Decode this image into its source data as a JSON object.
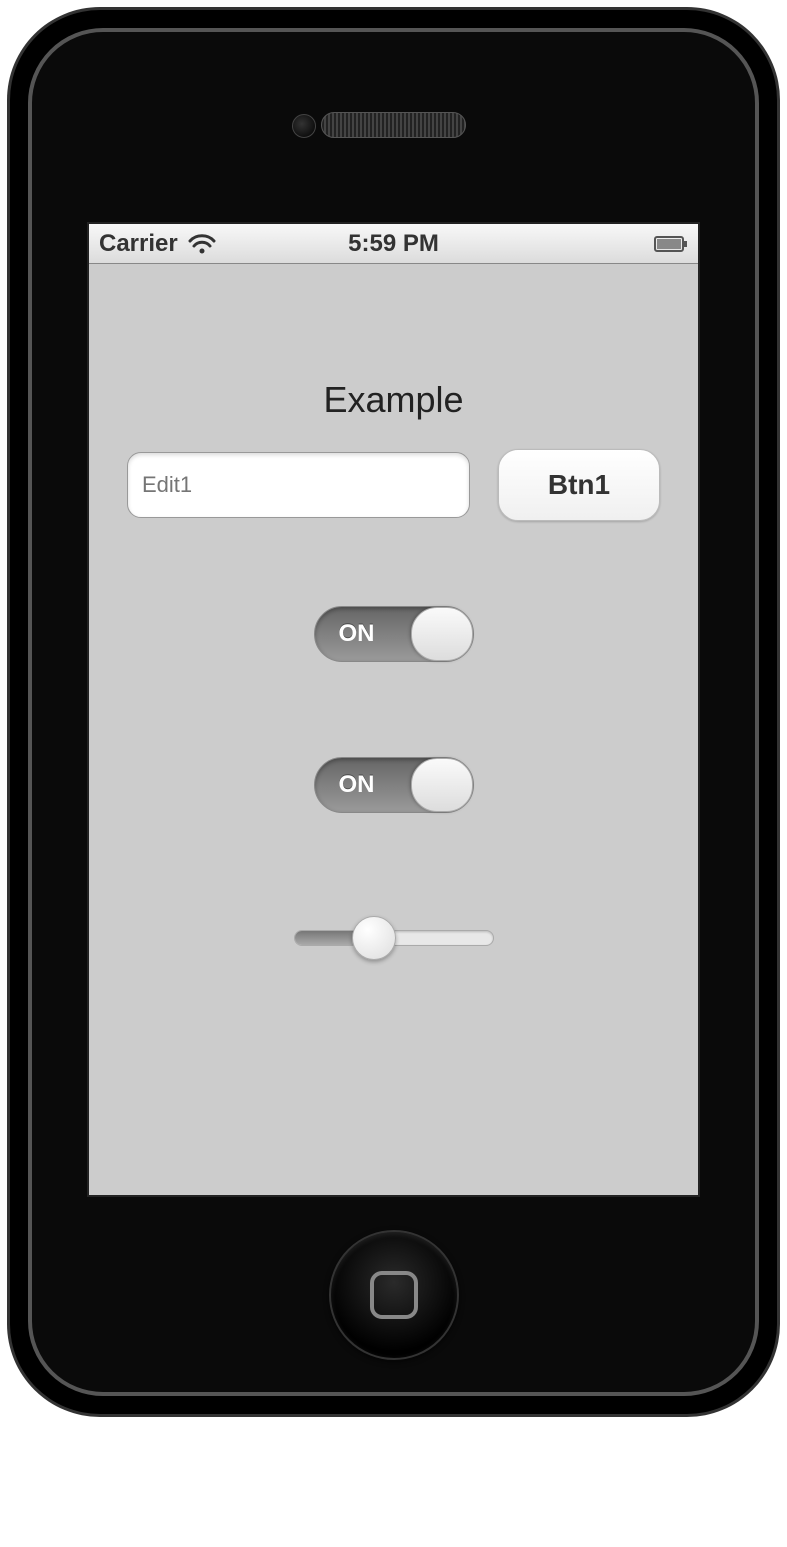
{
  "status_bar": {
    "carrier": "Carrier",
    "time": "5:59 PM"
  },
  "app": {
    "title": "Example",
    "edit1_placeholder": "Edit1",
    "btn1_label": "Btn1",
    "switch1": {
      "state": "ON"
    },
    "switch2": {
      "state": "ON"
    },
    "slider_value_percent": 40
  }
}
